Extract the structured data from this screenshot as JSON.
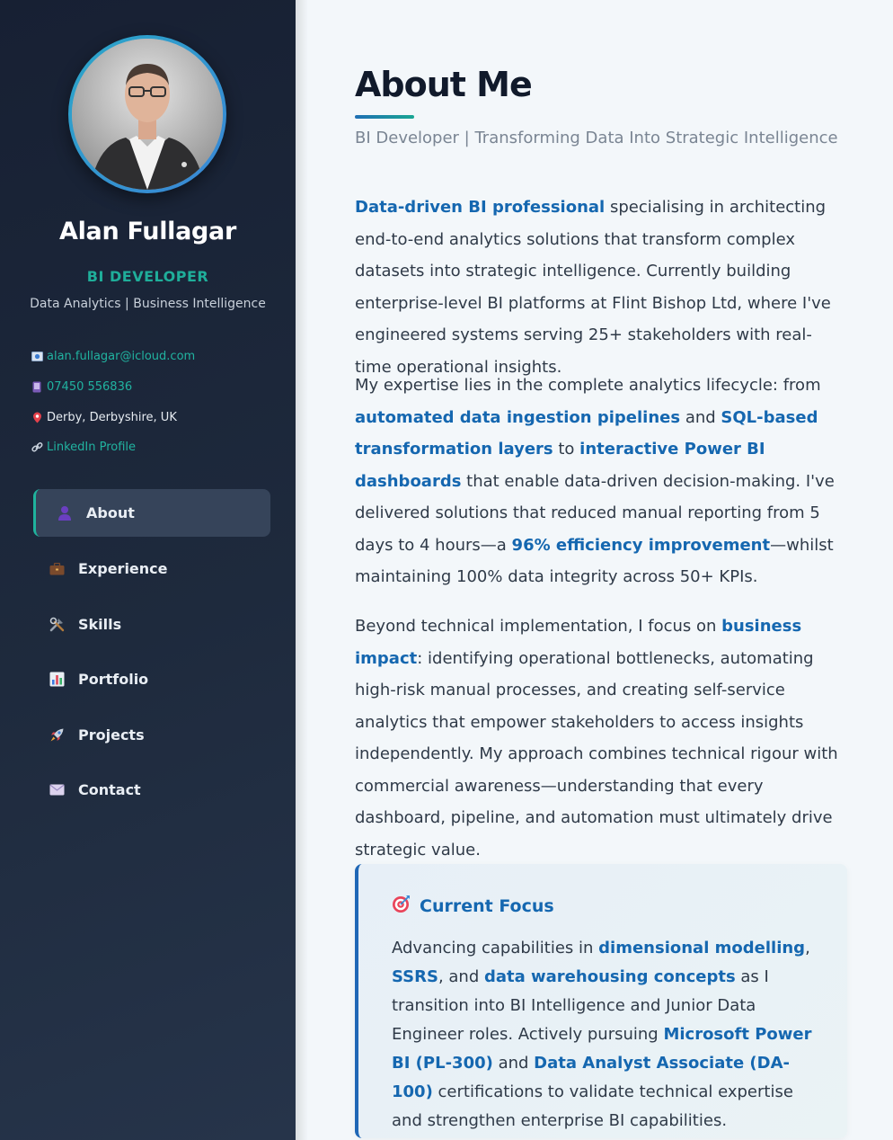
{
  "profile": {
    "name": "Alan Fullagar",
    "role": "BI DEVELOPER",
    "tagline": "Data Analytics | Business Intelligence"
  },
  "contact": {
    "email": "alan.fullagar@icloud.com",
    "phone": "07450 556836",
    "location": "Derby, Derbyshire, UK",
    "linkedin": "LinkedIn Profile"
  },
  "nav": {
    "about": "About",
    "experience": "Experience",
    "skills": "Skills",
    "portfolio": "Portfolio",
    "projects": "Projects",
    "contact": "Contact"
  },
  "main": {
    "title": "About Me",
    "subtitle": "BI Developer | Transforming Data Into Strategic Intelligence",
    "p1": {
      "hl1": "Data-driven BI professional",
      "t1": " specialising in architecting end-to-end analytics solutions that transform complex datasets into strategic intelligence. Currently building enterprise-level BI platforms at Flint Bishop Ltd, where I've engineered systems serving 25+ stakeholders with real-time operational insights."
    },
    "p2": {
      "t1": "My expertise lies in the complete analytics lifecycle: from ",
      "hl1": "automated data ingestion pipelines",
      "t2": " and ",
      "hl2": "SQL-based transformation layers",
      "t3": " to ",
      "hl3": "interactive Power BI dashboards",
      "t4": " that enable data-driven decision-making. I've delivered solutions that reduced manual reporting from 5 days to 4 hours—a ",
      "hl4": "96% efficiency improvement",
      "t5": "—whilst maintaining 100% data integrity across 50+ KPIs."
    },
    "p3": {
      "t1": "Beyond technical implementation, I focus on ",
      "hl1": "business impact",
      "t2": ": identifying operational bottlenecks, automating high-risk manual processes, and creating self-service analytics that empower stakeholders to access insights independently. My approach combines technical rigour with commercial awareness—understanding that every dashboard, pipeline, and automation must ultimately drive strategic value."
    }
  },
  "focus": {
    "heading": "Current Focus",
    "t1": "Advancing capabilities in ",
    "hl1": "dimensional modelling",
    "t2": ", ",
    "hl2": "SSRS",
    "t3": ", and ",
    "hl3": "data warehousing concepts",
    "t4": " as I transition into BI Intelligence and Junior Data Engineer roles. Actively pursuing ",
    "hl4": "Microsoft Power BI (PL-300)",
    "t5": " and ",
    "hl5": "Data Analyst Associate (DA-100)",
    "t6": " certifications to validate technical expertise and strengthen enterprise BI capabilities."
  },
  "colors": {
    "sidebar_bg": "#1e2a3d",
    "accent_teal": "#1fae9a",
    "highlight_blue": "#1567b0",
    "active_nav_bg": "#36445a"
  }
}
